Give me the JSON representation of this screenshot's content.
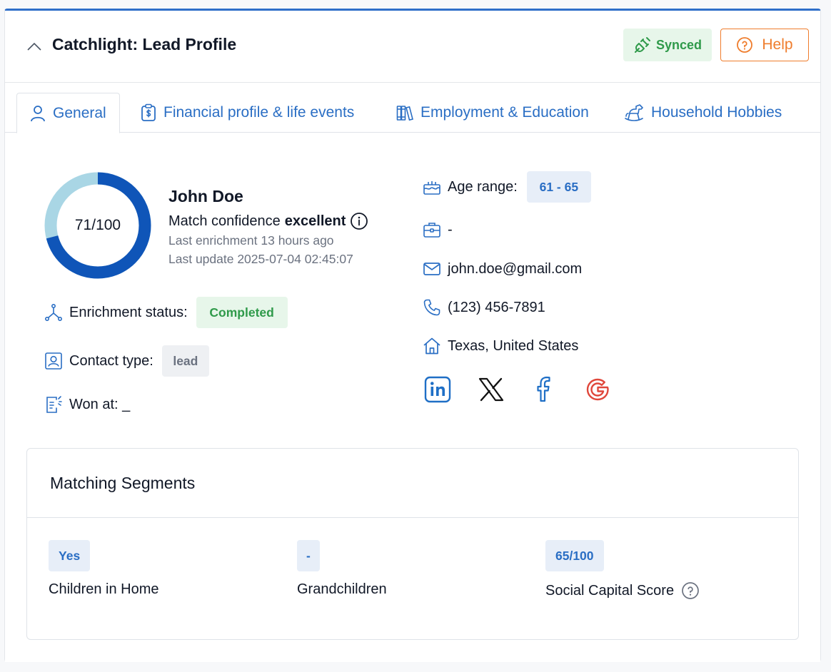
{
  "header": {
    "title": "Catchlight: Lead Profile",
    "synced_label": "Synced",
    "help_label": "Help"
  },
  "tabs": [
    {
      "label": "General",
      "icon": "user-icon",
      "active": true
    },
    {
      "label": "Financial profile & life events",
      "icon": "clipboard-dollar-icon",
      "active": false
    },
    {
      "label": "Employment & Education",
      "icon": "books-icon",
      "active": false
    },
    {
      "label": "Household Hobbies",
      "icon": "rocking-horse-icon",
      "active": false
    }
  ],
  "profile": {
    "score_label": "71/100",
    "score_fraction": 0.71,
    "name": "John Doe",
    "confidence_prefix": "Match confidence",
    "confidence_value": "excellent",
    "last_enrichment": "Last enrichment 13 hours ago",
    "last_update": "Last update 2025-07-04 02:45:07"
  },
  "details": {
    "enrichment_status_label": "Enrichment status:",
    "enrichment_status_value": "Completed",
    "contact_type_label": "Contact type:",
    "contact_type_value": "lead",
    "won_at_label": "Won at: _"
  },
  "contact": {
    "age_range_label": "Age range:",
    "age_range_value": "61 - 65",
    "job": "-",
    "email": "john.doe@gmail.com",
    "phone": "(123) 456-7891",
    "location": "Texas, United States"
  },
  "socials": [
    "linkedin-icon",
    "x-icon",
    "facebook-icon",
    "google-icon"
  ],
  "segments": {
    "title": "Matching Segments",
    "items": [
      {
        "value": "Yes",
        "label": "Children in Home"
      },
      {
        "value": "-",
        "label": "Grandchildren"
      },
      {
        "value": "65/100",
        "label": "Social Capital Score"
      }
    ]
  },
  "colors": {
    "accent": "#2a6ec4",
    "donut_fill": "#0f55b8",
    "donut_track": "#a9d6e5",
    "success": "#2f9a4a",
    "help": "#ef7d2d"
  }
}
